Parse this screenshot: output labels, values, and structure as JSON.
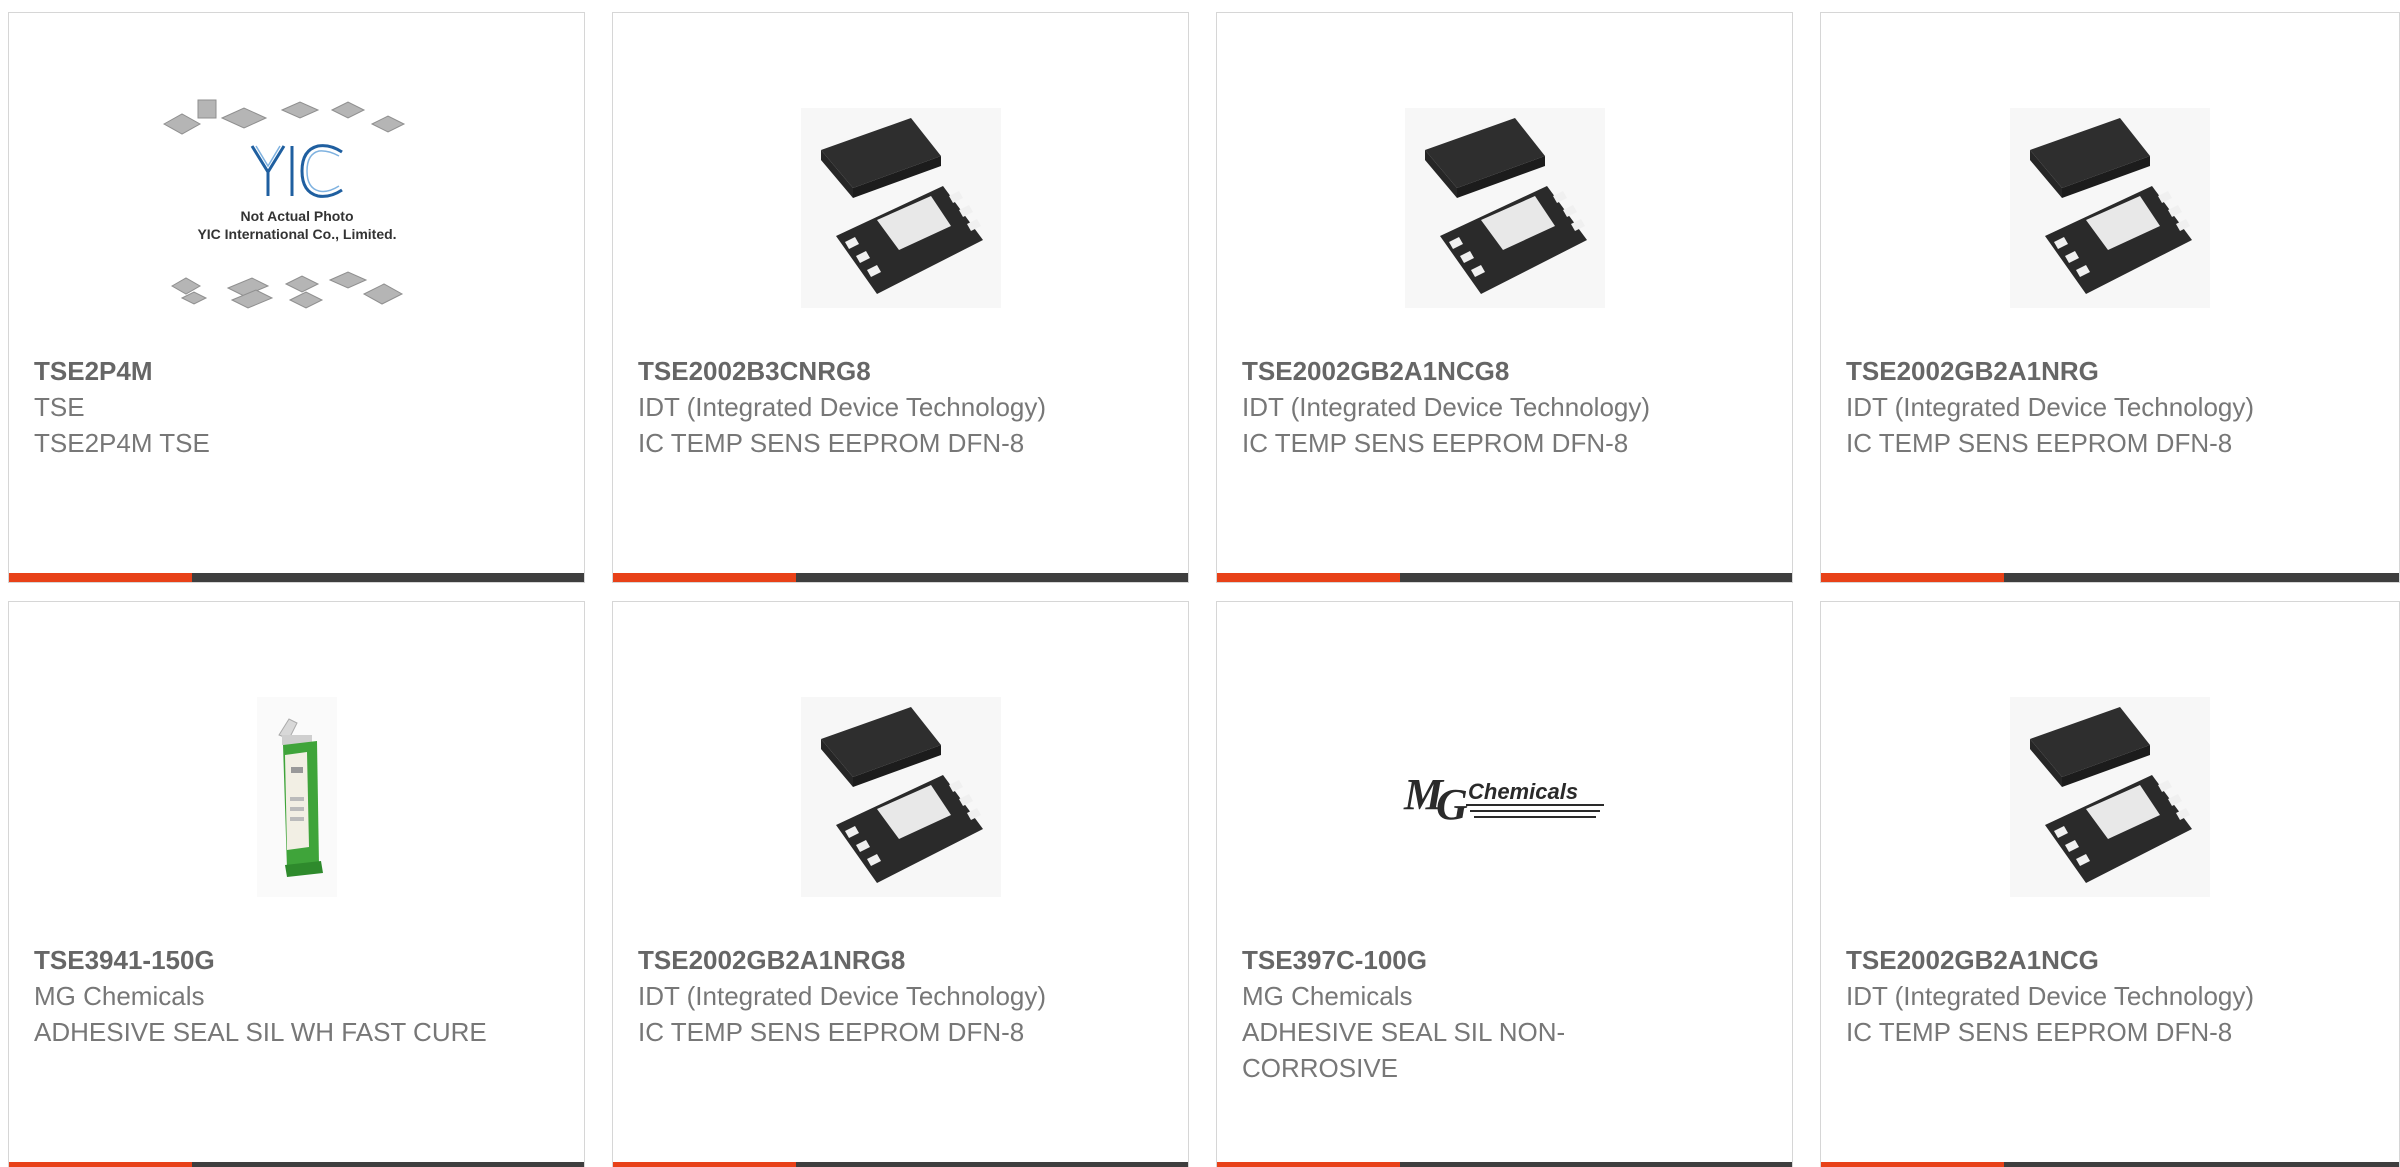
{
  "colors": {
    "accent_bar": "#e84118",
    "dark_bar": "#3e3e3e",
    "border": "#d6d6d6",
    "text": "#777777"
  },
  "products": [
    {
      "part_number": "TSE2P4M",
      "manufacturer": "TSE",
      "description": "TSE2P4M TSE",
      "image": "yic-placeholder-photo",
      "image_caption_line1": "Not Actual Photo",
      "image_caption_line2": "YIC International Co., Limited.",
      "image_logo": "YIC"
    },
    {
      "part_number": "TSE2002B3CNRG8",
      "manufacturer": "IDT (Integrated Device Technology)",
      "description": "IC TEMP SENS EEPROM DFN-8",
      "image": "dfn8-chip-photo"
    },
    {
      "part_number": "TSE2002GB2A1NCG8",
      "manufacturer": "IDT (Integrated Device Technology)",
      "description": "IC TEMP SENS EEPROM DFN-8",
      "image": "dfn8-chip-photo"
    },
    {
      "part_number": "TSE2002GB2A1NRG",
      "manufacturer": "IDT (Integrated Device Technology)",
      "description": "IC TEMP SENS EEPROM DFN-8",
      "image": "dfn8-chip-photo"
    },
    {
      "part_number": "TSE3941-150G",
      "manufacturer": "MG Chemicals",
      "description": "ADHESIVE SEAL SIL WH FAST CURE",
      "image": "sealant-tube-photo"
    },
    {
      "part_number": "TSE2002GB2A1NRG8",
      "manufacturer": "IDT (Integrated Device Technology)",
      "description": "IC TEMP SENS EEPROM DFN-8",
      "image": "dfn8-chip-photo"
    },
    {
      "part_number": "TSE397C-100G",
      "manufacturer": "MG Chemicals",
      "description": "ADHESIVE SEAL SIL NON-CORROSIVE",
      "image": "mg-chemicals-logo",
      "image_logo": "Chemicals"
    },
    {
      "part_number": "TSE2002GB2A1NCG",
      "manufacturer": "IDT (Integrated Device Technology)",
      "description": "IC TEMP SENS EEPROM DFN-8",
      "image": "dfn8-chip-photo"
    }
  ]
}
